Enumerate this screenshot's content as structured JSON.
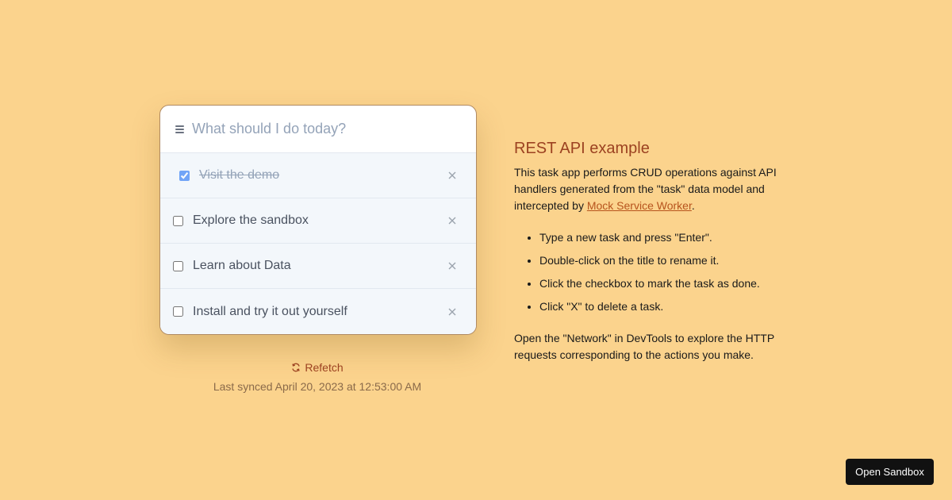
{
  "new_task": {
    "placeholder": "What should I do today?",
    "value": ""
  },
  "tasks": [
    {
      "title": "Visit the demo",
      "done": true
    },
    {
      "title": "Explore the sandbox",
      "done": false
    },
    {
      "title": "Learn about Data",
      "done": false
    },
    {
      "title": "Install and try it out yourself",
      "done": false
    }
  ],
  "refetch_label": "Refetch",
  "last_synced": "Last synced April 20, 2023 at 12:53:00 AM",
  "info": {
    "title": "REST API example",
    "intro_before_link": "This task app performs CRUD operations against API handlers generated from the \"task\" data model and intercepted by ",
    "link_text": "Mock Service Worker",
    "intro_after_link": ".",
    "instructions": [
      "Type a new task and press \"Enter\".",
      "Double-click on the title to rename it.",
      "Click the checkbox to mark the task as done.",
      "Click \"X\" to delete a task."
    ],
    "footer": "Open the \"Network\" in DevTools to explore the HTTP requests corresponding to the actions you make."
  },
  "sandbox_button": "Open Sandbox",
  "colors": {
    "background": "#fbd38d",
    "accent": "#9c4221",
    "link": "#b7541d"
  },
  "icons": {
    "menu": "menu-icon",
    "delete": "close-icon",
    "refetch": "refresh-icon"
  }
}
